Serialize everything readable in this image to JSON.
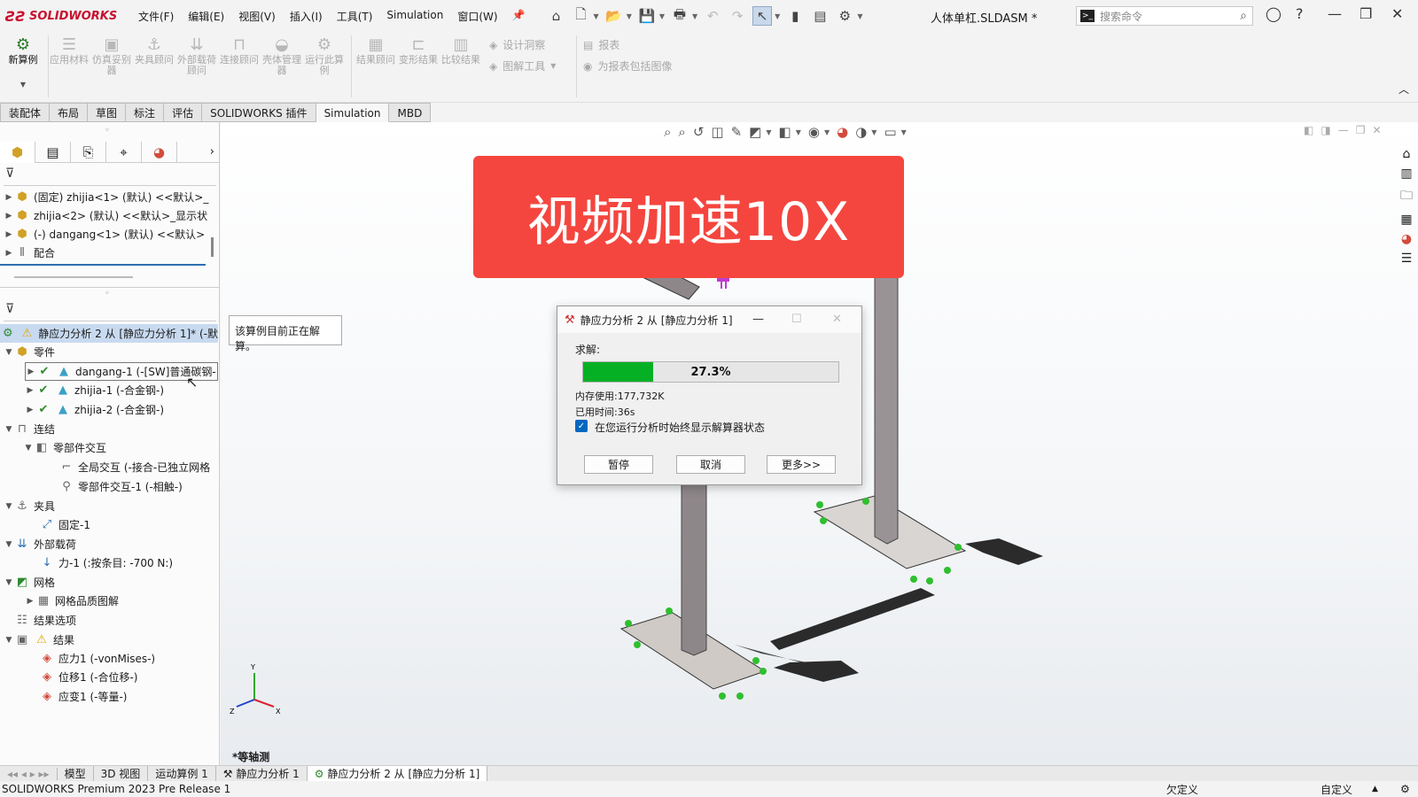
{
  "app": {
    "name": "SOLIDWORKS",
    "doc_title": "人体单杠.SLDASM *"
  },
  "menu": [
    "文件(F)",
    "编辑(E)",
    "视图(V)",
    "插入(I)",
    "工具(T)",
    "Simulation",
    "窗口(W)"
  ],
  "search": {
    "placeholder": "搜索命令"
  },
  "ribbon": {
    "new_study": "新算例",
    "buttons": [
      "应用材料",
      "仿真妥别器",
      "夹具顾问",
      "外部载荷顾问",
      "连接顾问",
      "壳体管理器",
      "运行此算例",
      "结果顾问",
      "变形结果",
      "比较结果"
    ],
    "small": [
      "设计洞察",
      "图解工具",
      "报表",
      "为报表包括图像"
    ]
  },
  "tabs": [
    "装配体",
    "布局",
    "草图",
    "标注",
    "评估",
    "SOLIDWORKS 插件",
    "Simulation",
    "MBD"
  ],
  "active_tab": "Simulation",
  "feature_tree": [
    {
      "label": "(固定) zhijia<1> (默认) <<默认>_"
    },
    {
      "label": "zhijia<2> (默认) <<默认>_显示状"
    },
    {
      "label": "(-) dangang<1> (默认) <<默认>"
    },
    {
      "label": "配合"
    }
  ],
  "sim_tree": {
    "study": "静应力分析 2 从 [静应力分析 1]* (-默",
    "parts_label": "零件",
    "parts": [
      "dangang-1 (-[SW]普通碳钢-",
      "zhijia-1 (-合金钢-)",
      "zhijia-2 (-合金钢-)"
    ],
    "connections": "连结",
    "component_interactions": "零部件交互",
    "global_interaction": "全局交互 (-接合-已独立网格",
    "interaction_1": "零部件交互-1 (-相触-)",
    "fixtures": "夹具",
    "fixed_1": "固定-1",
    "external_loads": "外部载荷",
    "force_1": "力-1 (:按条目: -700 N:)",
    "mesh": "网格",
    "mesh_quality": "网格品质图解",
    "result_options": "结果选项",
    "results": "结果",
    "stress": "应力1 (-vonMises-)",
    "displacement": "位移1 (-合位移-)",
    "strain": "应变1 (-等量-)"
  },
  "tooltip": "该算例目前正在解算。",
  "banner": "视频加速10X",
  "dialog": {
    "title": "静应力分析 2 从 [静应力分析 1]",
    "solve_label": "求解:",
    "progress": 27.3,
    "progress_text": "27.3%",
    "memory": "内存使用:177,732K",
    "elapsed": "已用时间:36s",
    "checkbox_label": "在您运行分析时始终显示解算器状态",
    "checkbox_checked": true,
    "pause": "暂停",
    "cancel": "取消",
    "more": "更多>>"
  },
  "view_label": "*等轴测",
  "triad": {
    "x": "X",
    "y": "Y",
    "z": "Z"
  },
  "bottom_tabs": [
    "模型",
    "3D 视图",
    "运动算例 1",
    "静应力分析 1",
    "静应力分析 2 从 [静应力分析 1]"
  ],
  "status": {
    "left": "SOLIDWORKS Premium 2023 Pre Release 1",
    "mid": "欠定义",
    "right": "自定义"
  },
  "colors": {
    "banner": "#f4463f",
    "progress": "#06b025",
    "beam": "#8a8386",
    "fixture": "#2fbf2f",
    "load": "#c03bd0"
  }
}
